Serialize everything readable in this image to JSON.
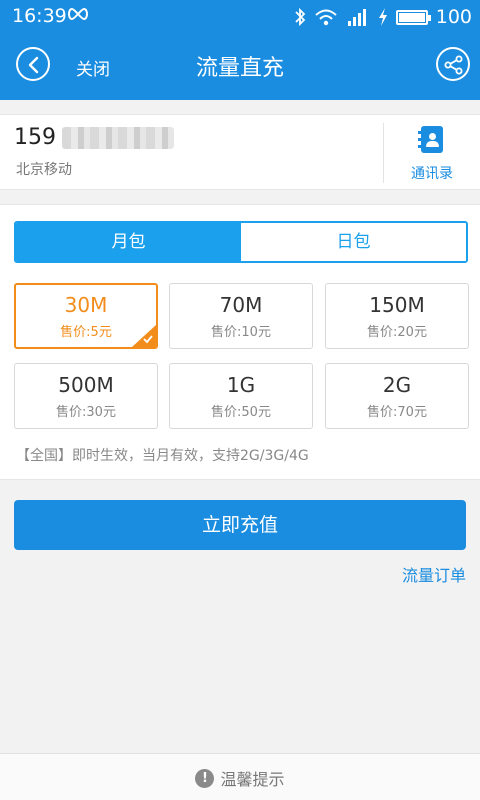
{
  "status_bar": {
    "time": "16:39",
    "battery": "100"
  },
  "nav": {
    "close_label": "关闭",
    "title": "流量直充"
  },
  "account": {
    "phone_prefix": "159",
    "carrier": "北京移动",
    "contacts_label": "通讯录"
  },
  "package": {
    "tabs": [
      {
        "label": "月包",
        "active": true
      },
      {
        "label": "日包",
        "active": false
      }
    ],
    "options": [
      {
        "size": "30M",
        "price": "售价:5元",
        "selected": true
      },
      {
        "size": "70M",
        "price": "售价:10元",
        "selected": false
      },
      {
        "size": "150M",
        "price": "售价:20元",
        "selected": false
      },
      {
        "size": "500M",
        "price": "售价:30元",
        "selected": false
      },
      {
        "size": "1G",
        "price": "售价:50元",
        "selected": false
      },
      {
        "size": "2G",
        "price": "售价:70元",
        "selected": false
      }
    ],
    "notice": "【全国】即时生效，当月有效，支持2G/3G/4G"
  },
  "actions": {
    "recharge_label": "立即充值",
    "orders_label": "流量订单"
  },
  "footer": {
    "tip_label": "温馨提示"
  },
  "colors": {
    "primary": "#1a8de0",
    "tab_accent": "#1aa0ec",
    "selected": "#f28d1c"
  },
  "icons": [
    "infinity-icon",
    "bluetooth-icon",
    "wifi-icon",
    "signal-icon",
    "charging-icon",
    "battery-icon",
    "back-icon",
    "share-icon",
    "contacts-icon",
    "check-icon",
    "warning-icon"
  ]
}
